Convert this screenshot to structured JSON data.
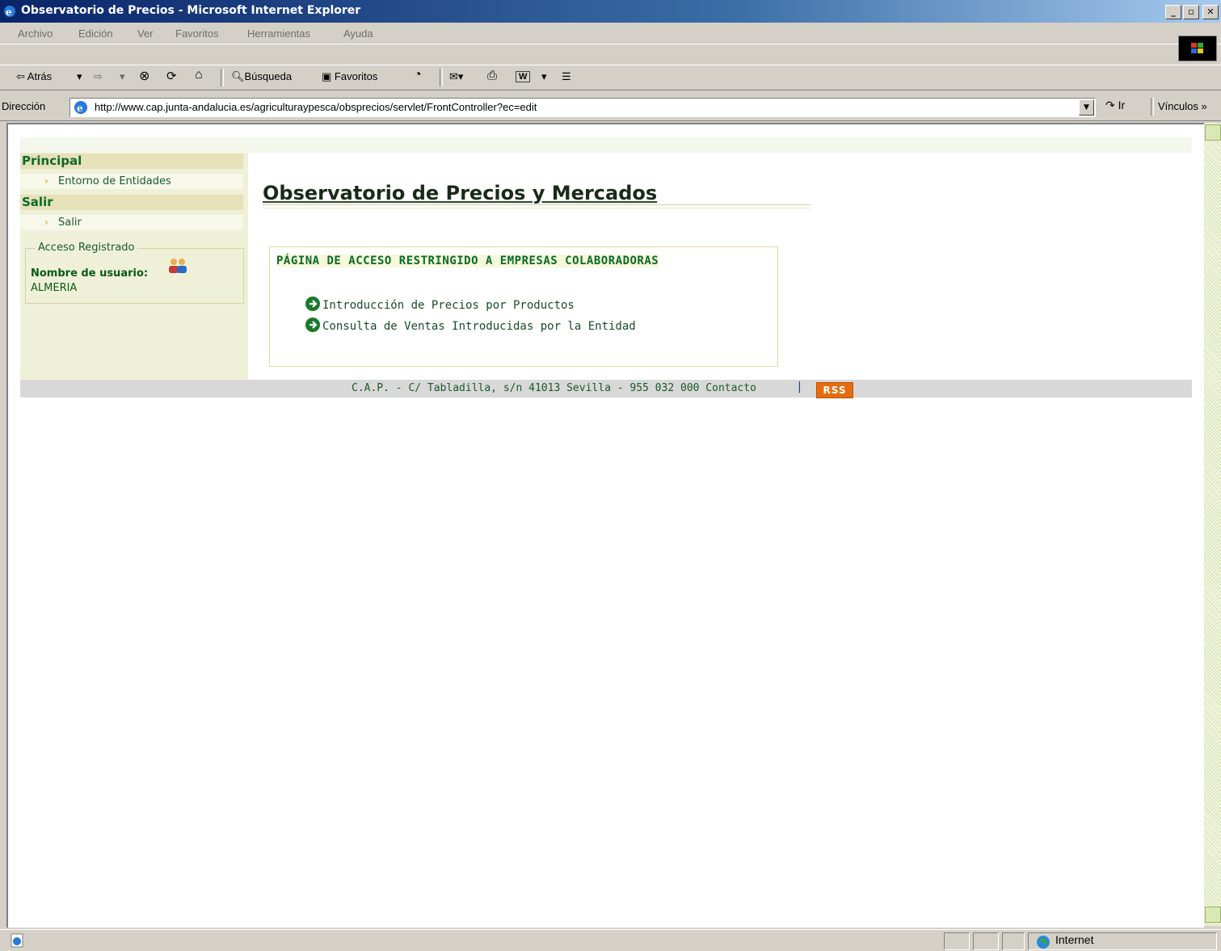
{
  "window": {
    "title": "Observatorio de Precios - Microsoft Internet Explorer",
    "controls": [
      "_",
      "▫",
      "✕"
    ]
  },
  "menu": {
    "items": [
      "Archivo",
      "Edición",
      "Ver",
      "Favoritos",
      "Herramientas",
      "Ayuda"
    ]
  },
  "toolbar": {
    "back": "⇦ Atrás",
    "back_drop": "▾",
    "forward": "⇨",
    "forward_drop": "▾",
    "stop": "⊗",
    "refresh": "⟳",
    "home": "⌂",
    "search": "Búsqueda",
    "favorites": "Favoritos",
    "history": "◔",
    "mail": "✉▾",
    "print": "⎙",
    "edit": "W",
    "edit_drop": "▾",
    "discuss": "☰"
  },
  "address": {
    "label": "Dirección",
    "url": "http://www.cap.junta-andalucia.es/agriculturaypesca/obsprecios/servlet/FrontController?ec=edit",
    "go": "Ir",
    "links": "Vínculos",
    "links_chevron": "»",
    "drop": "▼"
  },
  "sidebar": {
    "sections": [
      {
        "heading": "Principal",
        "items": [
          "Entorno de Entidades"
        ]
      },
      {
        "heading": "Salir",
        "items": [
          "Salir"
        ]
      }
    ],
    "arrow": "›",
    "access": {
      "legend": "Acceso Registrado",
      "user_label": "Nombre de usuario:",
      "user_value": "ALMERIA"
    }
  },
  "main": {
    "title": "Observatorio de Precios y Mercados",
    "restricted": {
      "title": "PÁGINA DE ACCESO RESTRINGIDO A EMPRESAS COLABORADORAS",
      "links": [
        "Introducción de Precios por Productos",
        "Consulta de Ventas Introducidas por la Entidad"
      ]
    }
  },
  "footer": {
    "text": "C.A.P. - C/ Tabladilla, s/n 41013 Sevilla - 955 032 000  Contacto",
    "separator": "|",
    "rss": "RSS"
  },
  "status": {
    "zone": "Internet"
  },
  "colors": {
    "accent_green": "#0a6a2a",
    "sidebar_bg": "#eff0d8",
    "rss_orange": "#e56d10",
    "titlebar": "#0a246a"
  }
}
